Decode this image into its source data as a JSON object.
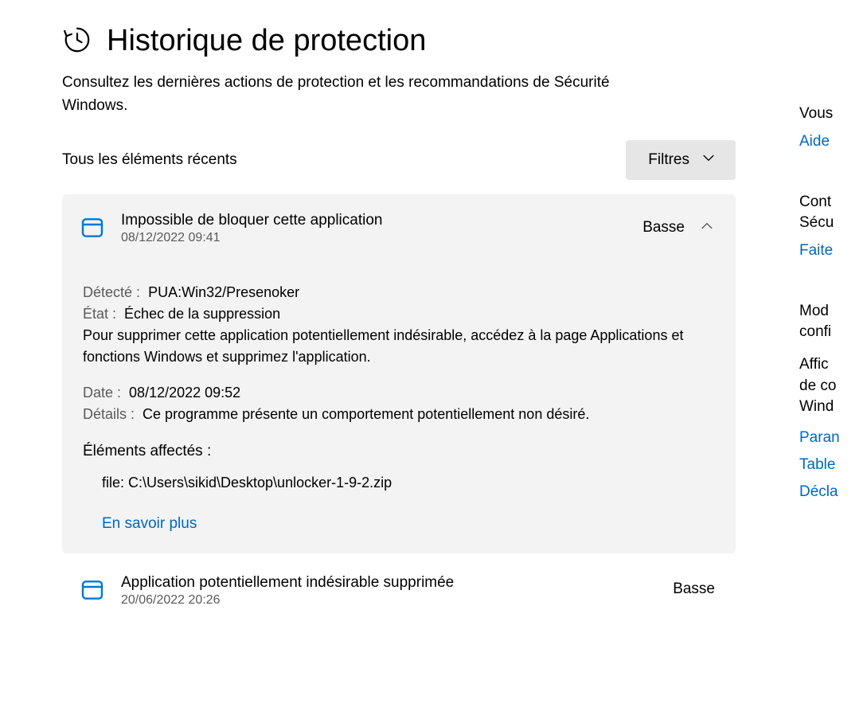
{
  "page": {
    "title": "Historique de protection",
    "subtitle": "Consultez les dernières actions de protection et les recommandations de Sécurité Windows."
  },
  "filterBar": {
    "sectionLabel": "Tous les éléments récents",
    "filterButton": "Filtres"
  },
  "cards": [
    {
      "title": "Impossible de bloquer cette application",
      "timestamp": "08/12/2022 09:41",
      "severity": "Basse",
      "details": {
        "detectedLabel": "Détecté :",
        "detectedValue": "PUA:Win32/Presenoker",
        "stateLabel": "État :",
        "stateValue": "Échec de la suppression",
        "instruction": "Pour supprimer cette application potentiellement indésirable, accédez à la page Applications et fonctions Windows et supprimez l'application.",
        "dateLabel": "Date :",
        "dateValue": "08/12/2022 09:52",
        "detailsLabel": "Détails :",
        "detailsValue": "Ce programme présente un comportement potentiellement non désiré.",
        "affectedTitle": "Éléments affectés :",
        "affectedFile": "file: C:\\Users\\sikid\\Desktop\\unlocker-1-9-2.zip",
        "learnMore": "En savoir plus"
      }
    },
    {
      "title": "Application potentiellement indésirable supprimée",
      "timestamp": "20/06/2022 20:26",
      "severity": "Basse"
    }
  ],
  "sidebar": {
    "group1Title": "Vous",
    "group1Link": "Aide",
    "group2Title1": "Cont",
    "group2Title2": "Sécu",
    "group2Link": "Faite",
    "group3Title1": "Mod",
    "group3Title2": "confi",
    "group3Desc1": "Affic",
    "group3Desc2": "de co",
    "group3Desc3": "Wind",
    "group3Link1": "Paran",
    "group3Link2": "Table",
    "group3Link3": "Décla"
  }
}
